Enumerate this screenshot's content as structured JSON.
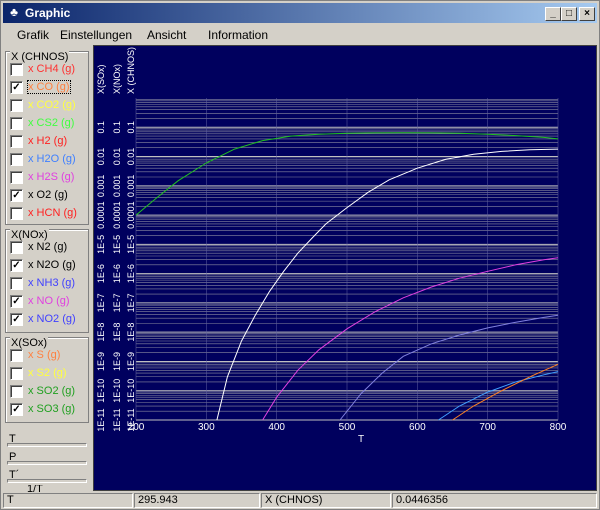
{
  "window": {
    "title": "Graphic",
    "min_label": "_",
    "max_label": "□",
    "close_label": "×"
  },
  "menu": [
    "Grafik",
    "Einstellungen",
    "Ansicht",
    "Information"
  ],
  "groups": {
    "chnos": {
      "title": "X (CHNOS)",
      "items": [
        {
          "label": "x CH4 (g)",
          "checked": false,
          "color": "#ff3030"
        },
        {
          "label": "x CO (g)",
          "checked": true,
          "color": "#ff8040"
        },
        {
          "label": "x CO2 (g)",
          "checked": false,
          "color": "#ffff40"
        },
        {
          "label": "x CS2 (g)",
          "checked": false,
          "color": "#40ff40"
        },
        {
          "label": "x H2 (g)",
          "checked": false,
          "color": "#ff2020"
        },
        {
          "label": "x H2O (g)",
          "checked": false,
          "color": "#4080ff"
        },
        {
          "label": "x H2S (g)",
          "checked": false,
          "color": "#e040e0"
        },
        {
          "label": "x O2 (g)",
          "checked": true,
          "color": "#000000"
        },
        {
          "label": "x HCN (g)",
          "checked": false,
          "color": "#ff2020"
        }
      ]
    },
    "nox": {
      "title": "X(NOx)",
      "items": [
        {
          "label": "x N2 (g)",
          "checked": false,
          "color": "#000000"
        },
        {
          "label": "x N2O (g)",
          "checked": true,
          "color": "#000000"
        },
        {
          "label": "x NH3 (g)",
          "checked": false,
          "color": "#4040ff"
        },
        {
          "label": "x NO (g)",
          "checked": true,
          "color": "#e040e0"
        },
        {
          "label": "x NO2 (g)",
          "checked": true,
          "color": "#4040ff"
        }
      ]
    },
    "sox": {
      "title": "X(SOx)",
      "items": [
        {
          "label": "x S (g)",
          "checked": false,
          "color": "#ff8040"
        },
        {
          "label": "x S2 (g)",
          "checked": false,
          "color": "#ffff40"
        },
        {
          "label": "x SO2 (g)",
          "checked": false,
          "color": "#20a020"
        },
        {
          "label": "x SO3 (g)",
          "checked": true,
          "color": "#20a020"
        }
      ]
    }
  },
  "sliders": [
    {
      "label": "T"
    },
    {
      "label": "P"
    },
    {
      "label": "T´"
    },
    {
      "label": "1/T"
    }
  ],
  "status": {
    "label1": "T",
    "value1": "295.943",
    "label2": "X (CHNOS)",
    "value2": "0.0446356"
  },
  "chart_data": {
    "type": "line",
    "xlabel": "T",
    "xlim": [
      200,
      800
    ],
    "x_ticks": [
      200,
      300,
      400,
      500,
      600,
      700,
      800
    ],
    "y_scale": "log",
    "ylim": [
      1e-11,
      1
    ],
    "y_axes": [
      "X(SOx)",
      "X(NOx)",
      "X (CHNOS)"
    ],
    "y_tick_labels": [
      "1E-11",
      "1E-10",
      "1E-9",
      "1E-8",
      "1E-7",
      "1E-6",
      "1E-5",
      "0.0001",
      "0.001",
      "0.01",
      "0.1"
    ],
    "grid": true,
    "background": "#00005e",
    "series": [
      {
        "color": "#20c020",
        "x": [
          200,
          230,
          260,
          300,
          340,
          380,
          420,
          460,
          500,
          540,
          580,
          620,
          660,
          700,
          740,
          780,
          800
        ],
        "y": [
          0.0001,
          0.0004,
          0.0015,
          0.006,
          0.018,
          0.035,
          0.05,
          0.058,
          0.062,
          0.064,
          0.065,
          0.064,
          0.062,
          0.058,
          0.052,
          0.045,
          0.04
        ]
      },
      {
        "color": "#ffffff",
        "x": [
          315,
          330,
          350,
          370,
          390,
          410,
          430,
          450,
          470,
          500,
          530,
          560,
          600,
          640,
          680,
          720,
          760,
          800
        ],
        "y": [
          1e-11,
          3e-10,
          5e-09,
          4e-08,
          2.5e-07,
          1.2e-06,
          5e-06,
          1.6e-05,
          5e-05,
          0.00018,
          0.0006,
          0.0016,
          0.004,
          0.008,
          0.012,
          0.015,
          0.017,
          0.018
        ]
      },
      {
        "color": "#e040e0",
        "x": [
          380,
          400,
          430,
          460,
          500,
          540,
          580,
          620,
          660,
          700,
          740,
          780,
          800
        ],
        "y": [
          1e-11,
          6e-11,
          5e-10,
          2.5e-09,
          1.3e-08,
          5e-08,
          1.5e-07,
          3.5e-07,
          7e-07,
          1.2e-06,
          2e-06,
          3e-06,
          3.5e-06
        ]
      },
      {
        "color": "#8080e0",
        "x": [
          490,
          520,
          550,
          580,
          620,
          660,
          700,
          740,
          780,
          800
        ],
        "y": [
          1e-11,
          8e-11,
          4e-10,
          1.5e-09,
          4e-09,
          8e-09,
          1.4e-08,
          2.2e-08,
          3.2e-08,
          3.8e-08
        ]
      },
      {
        "color": "#40a0ff",
        "x": [
          630,
          660,
          700,
          740,
          780,
          800
        ],
        "y": [
          1e-11,
          3e-11,
          9e-11,
          2e-10,
          3.5e-10,
          4.5e-10
        ]
      },
      {
        "color": "#ff8020",
        "x": [
          650,
          680,
          720,
          760,
          800
        ],
        "y": [
          1e-11,
          3e-11,
          1e-10,
          3e-10,
          8e-10
        ]
      }
    ]
  }
}
